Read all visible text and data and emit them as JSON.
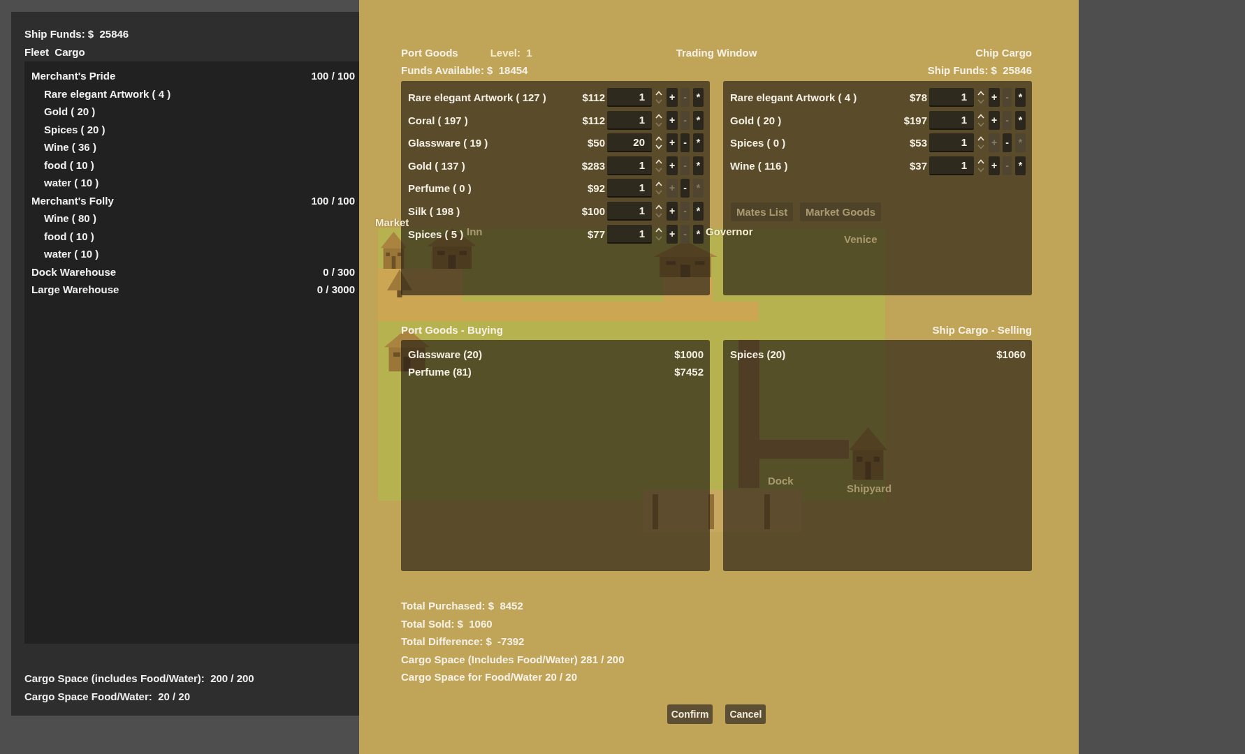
{
  "fleet_panel": {
    "ship_funds": "Ship Funds: $  25846",
    "title": "Fleet  Cargo",
    "items": [
      {
        "name": "Merchant's Pride",
        "capacity": "100 / 100",
        "children": [
          {
            "name": "Rare elegant Artwork ( 4 )"
          },
          {
            "name": "Gold ( 20 )"
          },
          {
            "name": "Spices ( 20 )"
          },
          {
            "name": "Wine ( 36 )"
          },
          {
            "name": "food ( 10 )"
          },
          {
            "name": "water ( 10 )"
          }
        ]
      },
      {
        "name": "Merchant's Folly",
        "capacity": "100 / 100",
        "children": [
          {
            "name": "Wine ( 80 )"
          },
          {
            "name": "food ( 10 )"
          },
          {
            "name": "water ( 10 )"
          }
        ]
      },
      {
        "name": "Dock Warehouse",
        "capacity": "0 / 300"
      },
      {
        "name": "Large Warehouse",
        "capacity": "0 / 3000"
      }
    ],
    "footer": [
      "Cargo Space (includes Food/Water):  200 / 200",
      "Cargo Space Food/Water:  20 / 20"
    ]
  },
  "map": {
    "places": [
      {
        "label": "Market"
      },
      {
        "label": "Inn"
      },
      {
        "label": "Governor"
      },
      {
        "label": "Venice"
      },
      {
        "label": "Dock"
      },
      {
        "label": "Shipyard"
      }
    ],
    "buttons": [
      "Mates List",
      "Market Goods"
    ]
  },
  "trading_window": {
    "title": "Trading Window",
    "port_goods": {
      "title": "Port Goods",
      "level": "Level:  1",
      "funds": "Funds Available: $  18454",
      "rows": [
        {
          "name": "Rare elegant Artwork ( 127 )",
          "price": "$112",
          "quantity": "1",
          "spin_up_disabled": false,
          "spin_down_disabled": true,
          "buttons": [
            {
              "label": "+",
              "disabled": false
            },
            {
              "label": "-",
              "disabled": true
            },
            {
              "label": "*",
              "disabled": false
            }
          ]
        },
        {
          "name": "Coral ( 197 )",
          "price": "$112",
          "quantity": "1",
          "spin_up_disabled": false,
          "spin_down_disabled": true,
          "buttons": [
            {
              "label": "+",
              "disabled": false
            },
            {
              "label": "-",
              "disabled": true
            },
            {
              "label": "*",
              "disabled": false
            }
          ]
        },
        {
          "name": "Glassware ( 19 )",
          "price": "$50",
          "quantity": "20",
          "spin_up_disabled": false,
          "spin_down_disabled": false,
          "buttons": [
            {
              "label": "+",
              "disabled": false
            },
            {
              "label": "-",
              "disabled": false
            },
            {
              "label": "*",
              "disabled": false
            }
          ]
        },
        {
          "name": "Gold ( 137 )",
          "price": "$283",
          "quantity": "1",
          "spin_up_disabled": false,
          "spin_down_disabled": true,
          "buttons": [
            {
              "label": "+",
              "disabled": false
            },
            {
              "label": "-",
              "disabled": true
            },
            {
              "label": "*",
              "disabled": false
            }
          ]
        },
        {
          "name": "Perfume ( 0 )",
          "price": "$92",
          "quantity": "1",
          "spin_up_disabled": false,
          "spin_down_disabled": true,
          "buttons": [
            {
              "label": "+",
              "disabled": true
            },
            {
              "label": "-",
              "disabled": false
            },
            {
              "label": "*",
              "disabled": true
            }
          ]
        },
        {
          "name": "Silk ( 198 )",
          "price": "$100",
          "quantity": "1",
          "spin_up_disabled": false,
          "spin_down_disabled": true,
          "buttons": [
            {
              "label": "+",
              "disabled": false
            },
            {
              "label": "-",
              "disabled": true
            },
            {
              "label": "*",
              "disabled": false
            }
          ]
        },
        {
          "name": "Spices ( 5 )",
          "price": "$77",
          "quantity": "1",
          "spin_up_disabled": false,
          "spin_down_disabled": true,
          "buttons": [
            {
              "label": "+",
              "disabled": false
            },
            {
              "label": "-",
              "disabled": true
            },
            {
              "label": "*",
              "disabled": false
            }
          ]
        }
      ]
    },
    "ship_cargo": {
      "title": "Chip Cargo",
      "funds": "Ship Funds: $  25846",
      "rows": [
        {
          "name": "Rare elegant Artwork ( 4 )",
          "price": "$78",
          "quantity": "1",
          "spin_up_disabled": false,
          "spin_down_disabled": true,
          "buttons": [
            {
              "label": "+",
              "disabled": false
            },
            {
              "label": "-",
              "disabled": true
            },
            {
              "label": "*",
              "disabled": false
            }
          ]
        },
        {
          "name": "Gold ( 20 )",
          "price": "$197",
          "quantity": "1",
          "spin_up_disabled": false,
          "spin_down_disabled": true,
          "buttons": [
            {
              "label": "+",
              "disabled": false
            },
            {
              "label": "-",
              "disabled": true
            },
            {
              "label": "*",
              "disabled": false
            }
          ]
        },
        {
          "name": "Spices ( 0 )",
          "price": "$53",
          "quantity": "1",
          "spin_up_disabled": false,
          "spin_down_disabled": true,
          "buttons": [
            {
              "label": "+",
              "disabled": true
            },
            {
              "label": "-",
              "disabled": false
            },
            {
              "label": "*",
              "disabled": true
            }
          ]
        },
        {
          "name": "Wine ( 116 )",
          "price": "$37",
          "quantity": "1",
          "spin_up_disabled": false,
          "spin_down_disabled": true,
          "buttons": [
            {
              "label": "+",
              "disabled": false
            },
            {
              "label": "-",
              "disabled": true
            },
            {
              "label": "*",
              "disabled": false
            }
          ]
        }
      ]
    },
    "buying": {
      "title": "Port Goods - Buying",
      "rows": [
        {
          "name": "Glassware (20)",
          "amount": "$1000"
        },
        {
          "name": "Perfume (81)",
          "amount": "$7452"
        }
      ]
    },
    "selling": {
      "title": "Ship Cargo - Selling",
      "rows": [
        {
          "name": "Spices (20)",
          "amount": "$1060"
        }
      ]
    },
    "totals": [
      "Total Purchased: $  8452",
      "Total Sold: $  1060",
      "Total Difference: $  -7392",
      "Cargo Space (Includes Food/Water) 281 / 200",
      "Cargo Space for Food/Water 20 / 20"
    ],
    "buttons": [
      "Confirm",
      "Cancel"
    ]
  }
}
